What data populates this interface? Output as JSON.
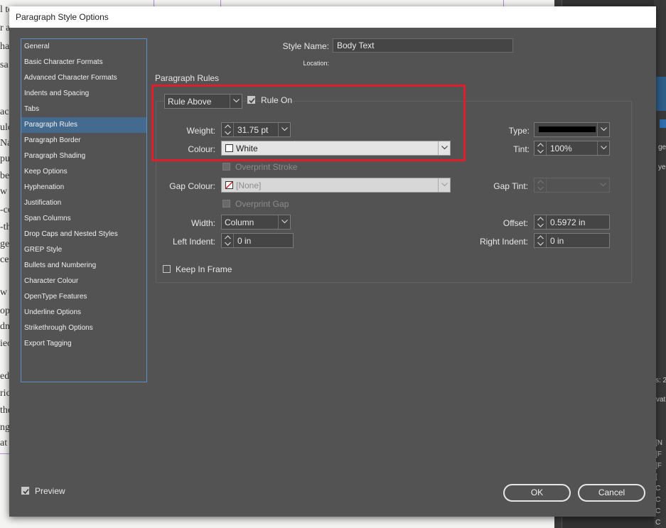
{
  "background": {
    "doc_fragments": [
      "l to",
      "r a",
      "ha",
      "sa",
      "ack",
      "ulc",
      "Na",
      "pu",
      "bec",
      "w c",
      "-co",
      "-th",
      "ge",
      "ce d",
      "w",
      "op",
      "dn",
      "ieo",
      "ed",
      "ric",
      "the",
      "ng",
      "at b"
    ],
    "panel_fragments": [
      "ges",
      "ye",
      "s: 2",
      "vat",
      "[N",
      "[F",
      "[F",
      "[",
      "C",
      "C",
      "C",
      "C"
    ]
  },
  "dialog": {
    "title": "Paragraph Style Options",
    "categories": [
      "General",
      "Basic Character Formats",
      "Advanced Character Formats",
      "Indents and Spacing",
      "Tabs",
      "Paragraph Rules",
      "Paragraph Border",
      "Paragraph Shading",
      "Keep Options",
      "Hyphenation",
      "Justification",
      "Span Columns",
      "Drop Caps and Nested Styles",
      "GREP Style",
      "Bullets and Numbering",
      "Character Colour",
      "OpenType Features",
      "Underline Options",
      "Strikethrough Options",
      "Export Tagging"
    ],
    "selected_category": "Paragraph Rules",
    "style_name_label": "Style Name:",
    "style_name_value": "Body Text",
    "location_label": "Location:",
    "section_title": "Paragraph Rules",
    "rule_select": "Rule Above",
    "rule_on_label": "Rule On",
    "rule_on_checked": true,
    "weight_label": "Weight:",
    "weight_value": "31.75 pt",
    "type_label": "Type:",
    "colour_label": "Colour:",
    "colour_value": "White",
    "tint_label": "Tint:",
    "tint_value": "100%",
    "overprint_stroke_label": "Overprint Stroke",
    "gap_colour_label": "Gap Colour:",
    "gap_colour_value": "[None]",
    "gap_tint_label": "Gap Tint:",
    "overprint_gap_label": "Overprint Gap",
    "width_label": "Width:",
    "width_value": "Column",
    "offset_label": "Offset:",
    "offset_value": "0.5972 in",
    "left_indent_label": "Left Indent:",
    "left_indent_value": "0 in",
    "right_indent_label": "Right Indent:",
    "right_indent_value": "0 in",
    "keep_in_frame_label": "Keep In Frame",
    "preview_label": "Preview",
    "preview_checked": true,
    "ok_label": "OK",
    "cancel_label": "Cancel"
  },
  "colors": {
    "highlight": "#e01e2b",
    "selection": "#456a90",
    "list_border": "#5c8fc7"
  }
}
